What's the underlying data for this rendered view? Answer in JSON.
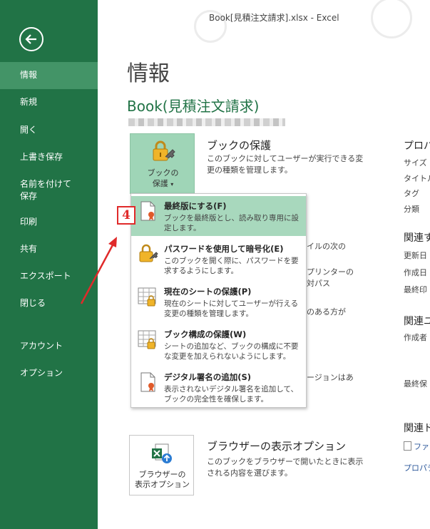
{
  "window": {
    "title": "Book[見積注文請求].xlsx - Excel"
  },
  "nav": {
    "items": [
      {
        "label": "情報"
      },
      {
        "label": "新規"
      },
      {
        "label": "開く"
      },
      {
        "label": "上書き保存"
      },
      {
        "label": "名前を付けて\n保存"
      },
      {
        "label": "印刷"
      },
      {
        "label": "共有"
      },
      {
        "label": "エクスポート"
      },
      {
        "label": "閉じる"
      },
      {
        "label": "アカウント"
      },
      {
        "label": "オプション"
      }
    ]
  },
  "page": {
    "heading": "情報",
    "book_name": "Book(見積注文請求)"
  },
  "protect": {
    "button_line1": "ブックの",
    "button_line2": "保護",
    "title": "ブックの保護",
    "description": "このブックに対してユーザーが実行できる変更の種類を管理します。"
  },
  "menu": {
    "items": [
      {
        "title": "最終版にする(F)",
        "desc": "ブックを最終版とし、読み取り専用に設定します。"
      },
      {
        "title": "パスワードを使用して暗号化(E)",
        "desc": "このブックを開く際に、パスワードを要求するようにします。"
      },
      {
        "title": "現在のシートの保護(P)",
        "desc": "現在のシートに対してユーザーが行える変更の種類を管理します。"
      },
      {
        "title": "ブック構成の保護(W)",
        "desc": "シートの追加など、ブックの構成に不要な変更を加えられないようにします。"
      },
      {
        "title": "デジタル署名の追加(S)",
        "desc": "表示されないデジタル署名を追加して、ブックの完全性を確保します。"
      }
    ]
  },
  "background_text": {
    "t1": "イルの次の",
    "t2": "プリンターの",
    "t3": "対パス",
    "t4": "のある方が",
    "t5": "ージョンはあ"
  },
  "browser": {
    "button_line1": "ブラウザーの",
    "button_line2": "表示オプション",
    "title": "ブラウザーの表示オプション",
    "description": "このブックをブラウザーで開いたときに表示される内容を選びます。"
  },
  "properties": {
    "heading": "プロパ",
    "size": "サイズ",
    "title": "タイトル",
    "tags": "タグ",
    "category": "分類",
    "related_dates": "関連す",
    "updated": "更新日",
    "created": "作成日",
    "printed": "最終印",
    "related_people": "関連ユ",
    "author": "作成者",
    "last_modified_by": "最終保",
    "related_docs": "関連ド",
    "file_link": "ファ",
    "all_props_link": "プロパテ"
  },
  "annotation": {
    "step_number": "4",
    "color": "#e02a2a"
  },
  "colors": {
    "nav_bg": "#217346",
    "nav_active": "#439467",
    "menu_highlight": "#a8d8bd",
    "accent": "#217346"
  }
}
